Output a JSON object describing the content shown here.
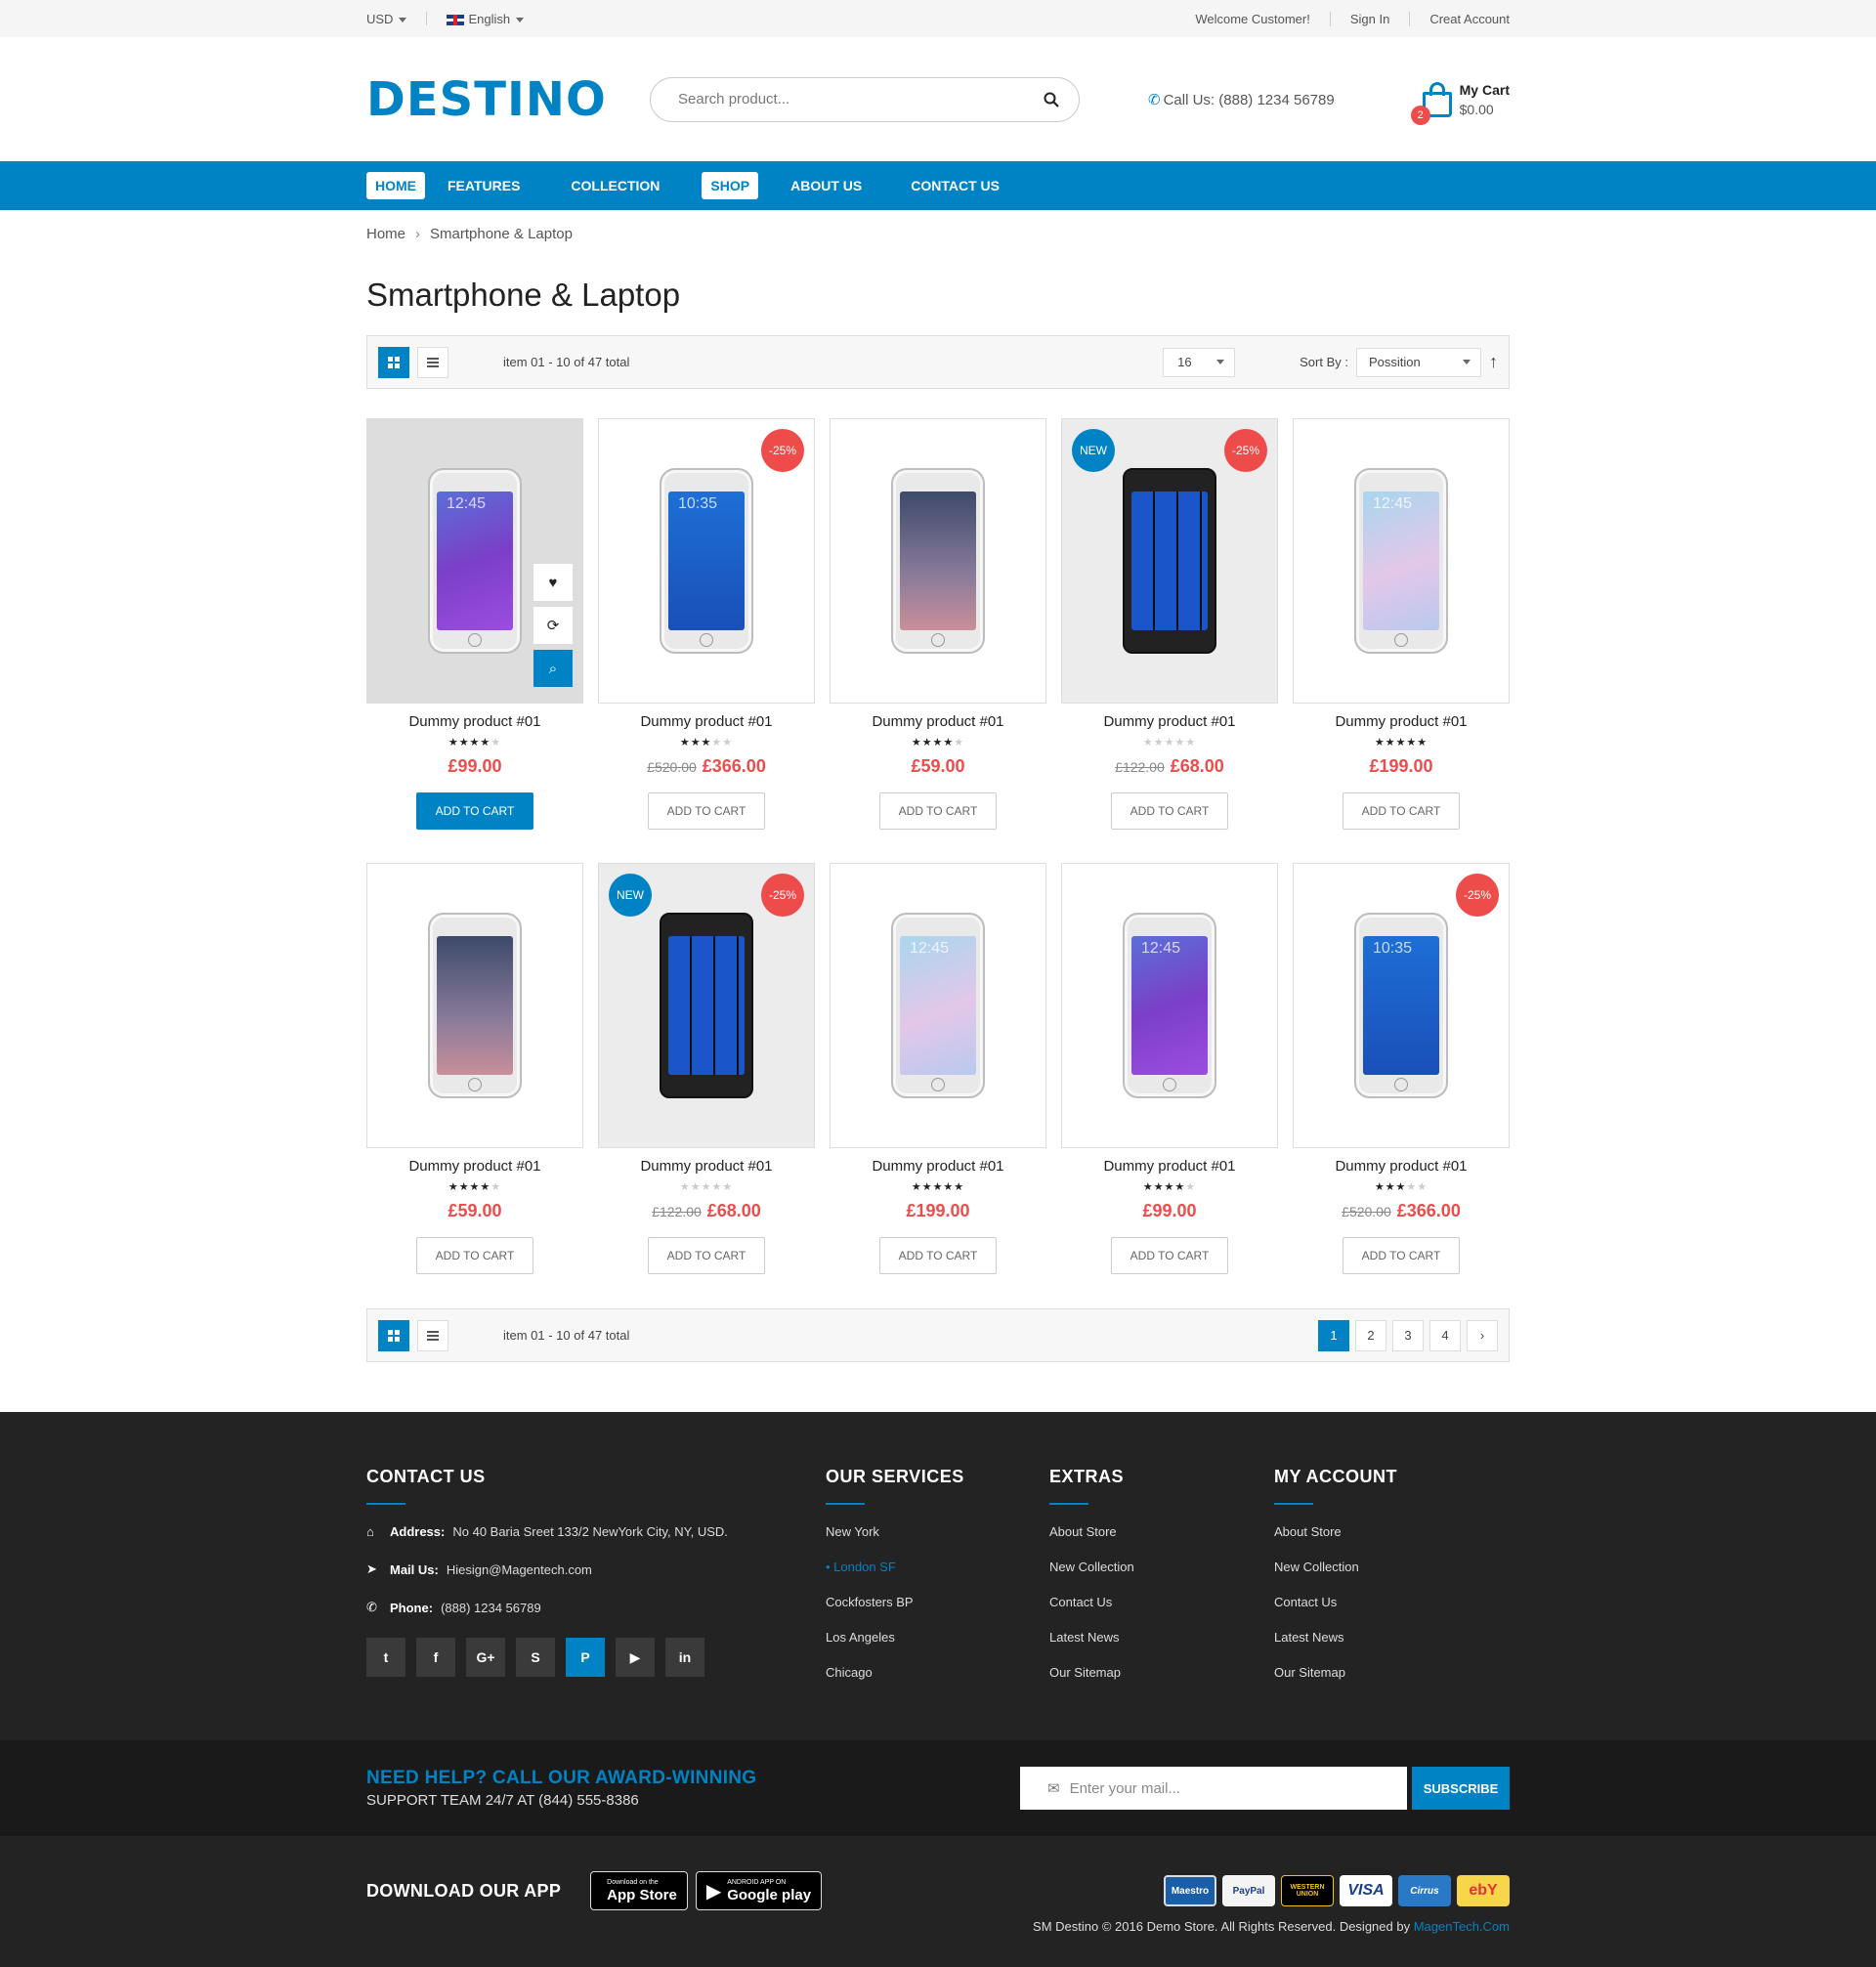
{
  "topbar": {
    "currency": "USD",
    "language": "English",
    "welcome": "Welcome Customer!",
    "signin": "Sign In",
    "create_account": "Creat Account"
  },
  "header": {
    "logo": "DESTINO",
    "search_placeholder": "Search product...",
    "call_label": "Call Us:",
    "call_number": "(888) 1234 56789",
    "cart_label": "My Cart",
    "cart_total": "$0.00",
    "cart_count": "2"
  },
  "nav": [
    "HOME",
    "FEATURES",
    "COLLECTION",
    "SHOP",
    "ABOUT US",
    "CONTACT US"
  ],
  "breadcrumb": {
    "home": "Home",
    "current": "Smartphone & Laptop"
  },
  "page_title": "Smartphone & Laptop",
  "toolbar": {
    "info": "item 01 - 10 of 47 total",
    "limit": "16",
    "sort_label": "Sort By :",
    "sort_value": "Possition"
  },
  "products": [
    {
      "name": "Dummy product #01",
      "rating": 4,
      "old_price": "",
      "price": "£99.00",
      "badge_new": "",
      "badge_sale": "",
      "button": "ADD TO CART",
      "phone": "samsung-note",
      "hover": true
    },
    {
      "name": "Dummy product #01",
      "rating": 3,
      "old_price": "£520.00",
      "price": "£366.00",
      "badge_new": "",
      "badge_sale": "-25%",
      "button": "ADD TO CART",
      "phone": "sony"
    },
    {
      "name": "Dummy product #01",
      "rating": 4,
      "old_price": "",
      "price": "£59.00",
      "badge_new": "",
      "badge_sale": "",
      "button": "ADD TO CART",
      "phone": "iphone"
    },
    {
      "name": "Dummy product #01",
      "rating": 0,
      "old_price": "£122.00",
      "price": "£68.00",
      "badge_new": "NEW",
      "badge_sale": "-25%",
      "button": "ADD TO CART",
      "phone": "lumia"
    },
    {
      "name": "Dummy product #01",
      "rating": 5,
      "old_price": "",
      "price": "£199.00",
      "badge_new": "",
      "badge_sale": "",
      "button": "ADD TO CART",
      "phone": "galaxy-edge"
    },
    {
      "name": "Dummy product #01",
      "rating": 4,
      "old_price": "",
      "price": "£59.00",
      "badge_new": "",
      "badge_sale": "",
      "button": "ADD TO CART",
      "phone": "iphone"
    },
    {
      "name": "Dummy product #01",
      "rating": 0,
      "old_price": "£122.00",
      "price": "£68.00",
      "badge_new": "NEW",
      "badge_sale": "-25%",
      "button": "ADD TO CART",
      "phone": "lumia"
    },
    {
      "name": "Dummy product #01",
      "rating": 5,
      "old_price": "",
      "price": "£199.00",
      "badge_new": "",
      "badge_sale": "",
      "button": "ADD TO CART",
      "phone": "galaxy-edge"
    },
    {
      "name": "Dummy product #01",
      "rating": 4,
      "old_price": "",
      "price": "£99.00",
      "badge_new": "",
      "badge_sale": "",
      "button": "ADD TO CART",
      "phone": "samsung-note"
    },
    {
      "name": "Dummy product #01",
      "rating": 3,
      "old_price": "£520.00",
      "price": "£366.00",
      "badge_new": "",
      "badge_sale": "-25%",
      "button": "ADD TO CART",
      "phone": "sony"
    }
  ],
  "pagination": [
    "1",
    "2",
    "3",
    "4",
    "›"
  ],
  "footer": {
    "contact": {
      "title": "CONTACT US",
      "address_label": "Address:",
      "address": "No 40 Baria Sreet 133/2 NewYork City, NY, USD.",
      "mail_label": "Mail Us:",
      "mail": "Hiesign@Magentech.com",
      "phone_label": "Phone:",
      "phone": "(888) 1234 56789"
    },
    "social": [
      "twitter-icon",
      "facebook-icon",
      "google-plus-icon",
      "skype-icon",
      "pinterest-icon",
      "youtube-icon",
      "linkedin-icon"
    ],
    "services": {
      "title": "OUR SERVICES",
      "items": [
        "New York",
        "London SF",
        "Cockfosters BP",
        "Los Angeles",
        "Chicago"
      ]
    },
    "extras": {
      "title": "EXTRAS",
      "items": [
        "About Store",
        "New Collection",
        "Contact Us",
        "Latest News",
        "Our Sitemap"
      ]
    },
    "account": {
      "title": "MY ACCOUNT",
      "items": [
        "About Store",
        "New Collection",
        "Contact Us",
        "Latest News",
        "Our Sitemap"
      ]
    }
  },
  "help": {
    "headline": "NEED HELP? CALL OUR AWARD-WINNING",
    "subline": "SUPPORT TEAM 24/7 AT (844) 555-8386",
    "mail_placeholder": "Enter your mail...",
    "subscribe": "SUBSCRIBE"
  },
  "app": {
    "title": "DOWNLOAD OUR APP",
    "appstore_small": "Download on the",
    "appstore_big": "App Store",
    "play_small": "ANDROID APP ON",
    "play_big": "Google play",
    "payments": [
      "Maestro",
      "PayPal",
      "WESTERN UNION",
      "VISA",
      "Cirrus",
      "ebY"
    ],
    "copyright": "SM Destino © 2016 Demo Store. All Rights Reserved. Designed by",
    "designer": "MagenTech.Com"
  },
  "colors": {
    "accent": "#0083c4",
    "sale": "#ee4b4b",
    "footer_bg": "#232323"
  }
}
